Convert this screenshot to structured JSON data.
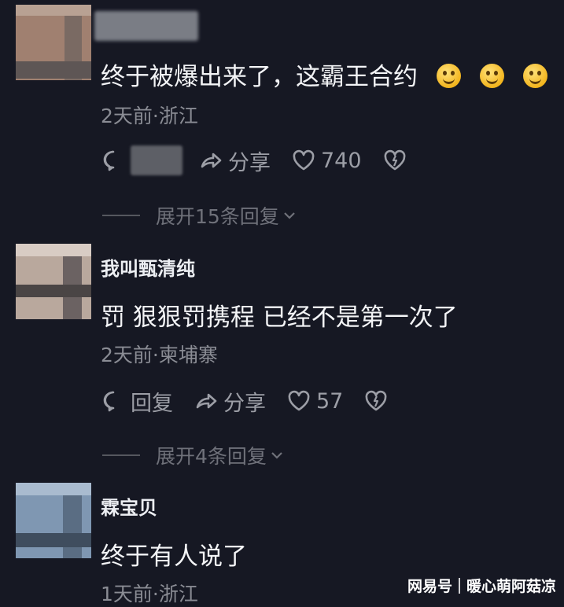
{
  "comments": [
    {
      "username": "",
      "text": "终于被爆出来了，这霸王合约",
      "emoji_count": 3,
      "meta": "2天前·浙江",
      "reply_label": "",
      "share_label": "分享",
      "likes": "740",
      "expand_label": "展开15条回复",
      "avatar_colors": [
        "#a08070",
        "#7a6a63",
        "#c9b8ad"
      ]
    },
    {
      "username": "我叫甄清纯",
      "text": "罚  狠狠罚携程  已经不是第一次了",
      "meta": "2天前·柬埔寨",
      "reply_label": "回复",
      "share_label": "分享",
      "likes": "57",
      "expand_label": "展开4条回复",
      "avatar_colors": [
        "#b9a89d",
        "#6b6262",
        "#d8ccc4"
      ]
    },
    {
      "username": "霖宝贝",
      "text": "终于有人说了",
      "meta": "1天前·浙江",
      "avatar_colors": [
        "#7f97b2",
        "#5a6d83",
        "#a9bbcf"
      ]
    }
  ],
  "watermark": {
    "brand": "网易号",
    "author": "暖心萌阿菇凉"
  },
  "icons": [
    "comment-bubble-icon",
    "share-arrow-icon",
    "heart-icon",
    "broken-heart-icon",
    "chevron-down-icon",
    "smile-emoji-icon"
  ]
}
